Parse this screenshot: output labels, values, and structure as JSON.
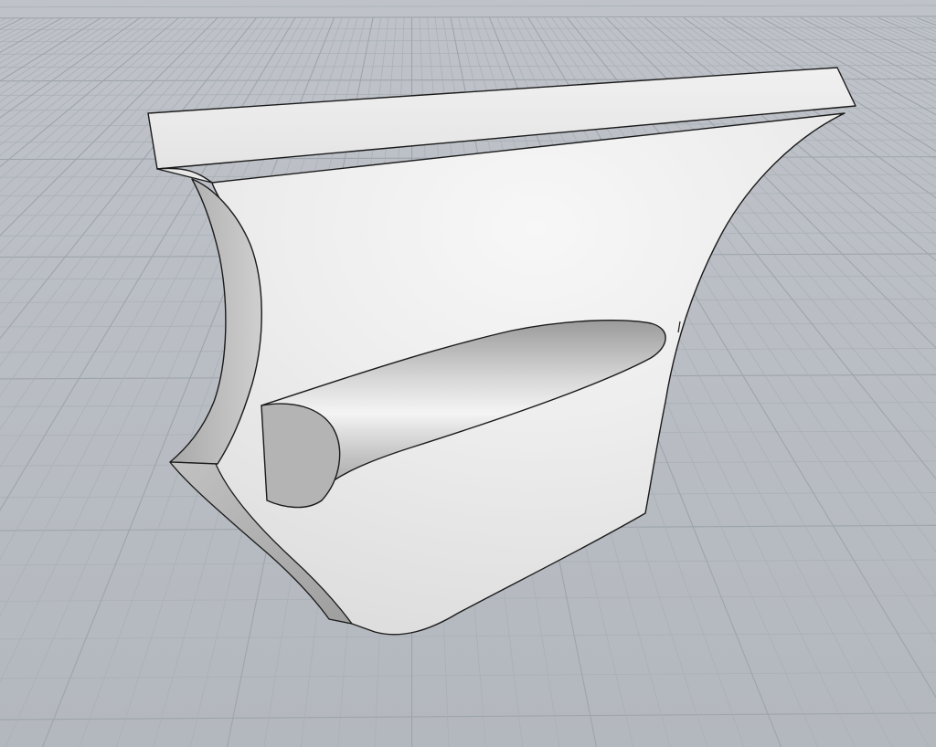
{
  "viewport": {
    "background_color": "#b9bdc3",
    "grid_minor_color": "#aab0b7",
    "grid_major_color": "#9ea4ac",
    "model_fill_color": "#eeeeee",
    "model_edge_color": "#1a1a1a",
    "grid_visible": true,
    "display_mode": "shaded"
  },
  "model": {
    "name_icon": "3d-solid-icon",
    "parts": [
      "top-flange",
      "curved-body",
      "side-notch",
      "rod-bulge"
    ]
  }
}
